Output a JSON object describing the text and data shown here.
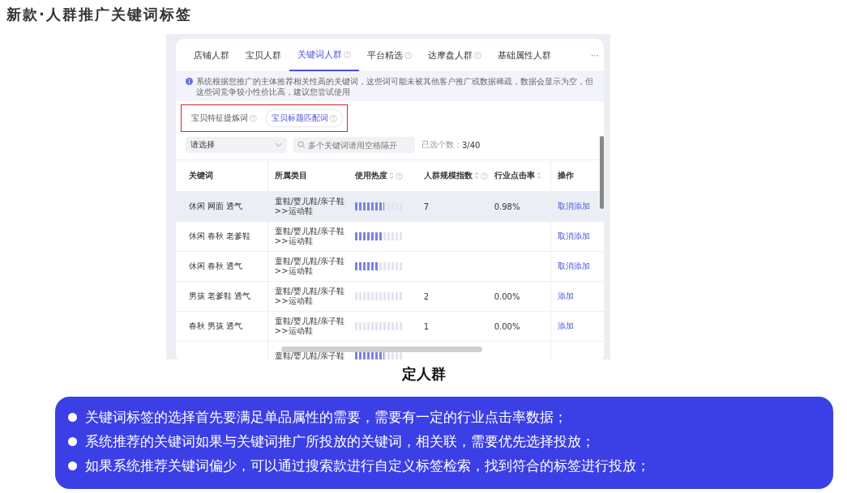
{
  "title": "新款·人群推广关键词标签",
  "tabs": [
    {
      "label": "店铺人群",
      "help": false,
      "selected": false
    },
    {
      "label": "宝贝人群",
      "help": false,
      "selected": false
    },
    {
      "label": "关键词人群",
      "help": true,
      "selected": true
    },
    {
      "label": "平台精选",
      "help": true,
      "selected": false
    },
    {
      "label": "达摩盘人群",
      "help": true,
      "selected": false
    },
    {
      "label": "基础属性人群",
      "help": false,
      "selected": false
    }
  ],
  "more": "···",
  "notice": "系统根据您推广的主体推荐相关性高的关键词，这些词可能未被其他客户推广或数据稀疏，数据会显示为空，但这些词竞争较小性价比高，建议您尝试使用",
  "sub_tabs": [
    {
      "label": "宝贝特征提炼词",
      "selected": false
    },
    {
      "label": "宝贝标题匹配词",
      "selected": true
    }
  ],
  "filter": {
    "select": "请选择",
    "search_placeholder": "多个关键词请用空格隔开",
    "count_label": "已选个数：",
    "count": "3/40"
  },
  "table": {
    "columns": [
      {
        "label": "关键词",
        "sortable": false,
        "help": false
      },
      {
        "label": "所属类目",
        "sortable": false,
        "help": false
      },
      {
        "label": "使用热度",
        "sortable": true,
        "help": true
      },
      {
        "label": "人群规模指数",
        "sortable": true,
        "help": true
      },
      {
        "label": "行业点击率",
        "sortable": true,
        "help": false
      },
      {
        "label": "操作",
        "sortable": false,
        "help": false
      }
    ],
    "rows": [
      {
        "keyword": "休闲 网面 透气",
        "category": [
          "童鞋/婴儿鞋/亲子鞋",
          ">>运动鞋"
        ],
        "level": 0.6,
        "crowd": "7",
        "ctr": "0.98%",
        "action": "取消添加",
        "selected": true
      },
      {
        "keyword": "休闲 春秋 老爹鞋",
        "category": [
          "童鞋/婴儿鞋/亲子鞋",
          ">>运动鞋"
        ],
        "level": 0.55,
        "action": "取消添加",
        "selected": false
      },
      {
        "keyword": "休闲 春秋 透气",
        "category": [
          "童鞋/婴儿鞋/亲子鞋",
          ">>运动鞋"
        ],
        "level": 0.5,
        "action": "取消添加",
        "selected": false
      },
      {
        "keyword": "男孩 老爹鞋 透气",
        "category": [
          "童鞋/婴儿鞋/亲子鞋",
          ">>运动鞋"
        ],
        "crowd": "2",
        "ctr": "0.00%",
        "action": "添加",
        "selected": false
      },
      {
        "keyword": "春秋 男孩 透气",
        "category": [
          "童鞋/婴儿鞋/亲子鞋",
          ">>运动鞋"
        ],
        "crowd": "1",
        "ctr": "0.00%",
        "action": "添加",
        "selected": false
      },
      {
        "category": [
          "童鞋/婴儿鞋/亲子鞋"
        ],
        "level": 0.6,
        "selected": false
      }
    ]
  },
  "caption": "定人群",
  "points": [
    "关键词标签的选择首先要满足单品属性的需要，需要有一定的行业点击率数据；",
    "系统推荐的关键词如果与关键词推广所投放的关键词，相关联，需要优先选择投放；",
    "如果系统推荐关键词偏少，可以通过搜索款进行自定义标签检索，找到符合的标签进行投放；"
  ]
}
